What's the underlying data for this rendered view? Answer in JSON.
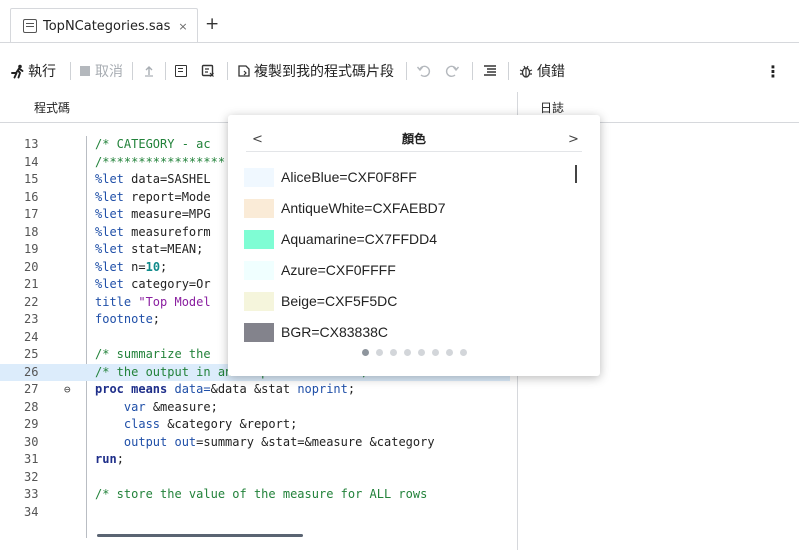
{
  "tabs": [
    {
      "label": "TopNCategories.sas",
      "close": "×"
    }
  ],
  "newtab_label": "+",
  "toolbar": {
    "run": "執行",
    "cancel": "取消",
    "copy_to_snippets": "複製到我的程式碼片段",
    "debug": "偵錯",
    "more": "⋮"
  },
  "panels": {
    "code": "程式碼",
    "log": "日誌"
  },
  "code_lines": [
    {
      "n": "13",
      "t": [
        [
          "c-com",
          "/* CATEGORY - ac"
        ]
      ]
    },
    {
      "n": "14",
      "t": [
        [
          "c-com",
          "/*****************"
        ]
      ]
    },
    {
      "n": "15",
      "t": [
        [
          "c-kw",
          "%let"
        ],
        [
          "c-id",
          " data=SASHEL"
        ]
      ]
    },
    {
      "n": "16",
      "t": [
        [
          "c-kw",
          "%let"
        ],
        [
          "c-id",
          " report=Mode"
        ]
      ]
    },
    {
      "n": "17",
      "t": [
        [
          "c-kw",
          "%let"
        ],
        [
          "c-id",
          " measure=MPG"
        ]
      ]
    },
    {
      "n": "18",
      "t": [
        [
          "c-kw",
          "%let"
        ],
        [
          "c-id",
          " measureform"
        ]
      ]
    },
    {
      "n": "19",
      "t": [
        [
          "c-kw",
          "%let"
        ],
        [
          "c-id",
          " stat=MEAN;"
        ]
      ]
    },
    {
      "n": "20",
      "t": [
        [
          "c-kw",
          "%let"
        ],
        [
          "c-id",
          " n="
        ],
        [
          "c-num",
          "10"
        ],
        [
          "c-id",
          ";"
        ]
      ]
    },
    {
      "n": "21",
      "t": [
        [
          "c-kw",
          "%let"
        ],
        [
          "c-id",
          " category=Or"
        ]
      ]
    },
    {
      "n": "22",
      "t": [
        [
          "c-kw",
          "title"
        ],
        [
          "c-id",
          " "
        ],
        [
          "c-str",
          "\"Top Model"
        ]
      ]
    },
    {
      "n": "23",
      "t": [
        [
          "c-kw",
          "footnote"
        ],
        [
          "c-id",
          ";"
        ]
      ]
    },
    {
      "n": "24",
      "t": []
    },
    {
      "n": "25",
      "t": [
        [
          "c-com",
          "/* summarize the"
        ]
      ]
    },
    {
      "n": "26",
      "t": [
        [
          "c-com",
          "/* the output in an output data set */"
        ]
      ],
      "hl": true
    },
    {
      "n": "27",
      "t": [
        [
          "c-kwb",
          "proc means"
        ],
        [
          "c-kw",
          " data="
        ],
        [
          "c-id",
          "&data &stat "
        ],
        [
          "c-kw",
          "noprint"
        ],
        [
          "c-id",
          ";"
        ]
      ],
      "fold": "⊖"
    },
    {
      "n": "28",
      "t": [
        [
          "c-id",
          "    "
        ],
        [
          "c-kw",
          "var"
        ],
        [
          "c-id",
          " &measure;"
        ]
      ]
    },
    {
      "n": "29",
      "t": [
        [
          "c-id",
          "    "
        ],
        [
          "c-kw",
          "class"
        ],
        [
          "c-id",
          " &category &report;"
        ]
      ]
    },
    {
      "n": "30",
      "t": [
        [
          "c-id",
          "    "
        ],
        [
          "c-kw",
          "output out"
        ],
        [
          "c-id",
          "=summary &stat=&measure &category"
        ]
      ]
    },
    {
      "n": "31",
      "t": [
        [
          "c-kwb",
          "run"
        ],
        [
          "c-id",
          ";"
        ]
      ]
    },
    {
      "n": "32",
      "t": []
    },
    {
      "n": "33",
      "t": [
        [
          "c-com",
          "/* store the value of the measure for ALL rows"
        ]
      ]
    },
    {
      "n": "34",
      "t": []
    }
  ],
  "popup": {
    "title": "顏色",
    "prev": "<",
    "next": ">",
    "colors": [
      {
        "label": "AliceBlue=CXF0F8FF",
        "hex": "#F0F8FF"
      },
      {
        "label": "AntiqueWhite=CXFAEBD7",
        "hex": "#FAEBD7"
      },
      {
        "label": "Aquamarine=CX7FFDD4",
        "hex": "#7FFDD4"
      },
      {
        "label": "Azure=CXF0FFFF",
        "hex": "#F0FFFF"
      },
      {
        "label": "Beige=CXF5F5DC",
        "hex": "#F5F5DC"
      },
      {
        "label": "BGR=CX83838C",
        "hex": "#83838C"
      }
    ],
    "page_count": 8,
    "active_page": 1
  }
}
